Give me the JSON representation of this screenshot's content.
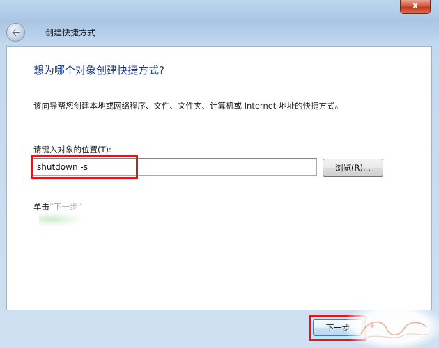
{
  "window": {
    "title": "创建快捷方式",
    "close_label": "x"
  },
  "wizard": {
    "heading": "想为哪个对象创建快捷方式?",
    "description": "该向导帮您创建本地或网络程序、文件、文件夹、计算机或 Internet 地址的快捷方式。",
    "location_label": "请键入对象的位置(T):",
    "location_value": "shutdown -s",
    "browse_label": "浏览(R)...",
    "hint": "单击“下一步”"
  },
  "footer": {
    "next_label": "下一步"
  },
  "colors": {
    "highlight": "#e0161b",
    "heading": "#1b3c8c",
    "frame": "#a9c6e4"
  },
  "icons": {
    "back": "back-arrow-icon",
    "close": "close-icon"
  }
}
